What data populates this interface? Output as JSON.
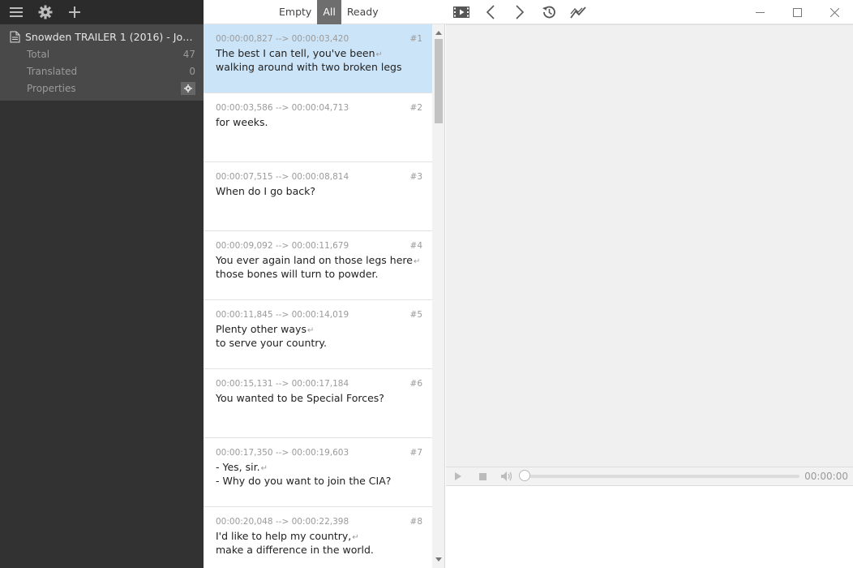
{
  "window_title": "",
  "sidebar": {
    "toolbar": {
      "menu_icon": "hamburger-icon",
      "settings_icon": "gear-icon",
      "add_icon": "plus-icon"
    },
    "file_name": "Snowden TRAILER 1 (2016) - Josep...",
    "stats": [
      {
        "label": "Total",
        "value": "47"
      },
      {
        "label": "Translated",
        "value": "0"
      }
    ],
    "properties_label": "Properties"
  },
  "filters": {
    "empty": "Empty",
    "all": "All",
    "ready": "Ready",
    "active": "All"
  },
  "nav_icons": [
    "video-icon",
    "chevron-left-icon",
    "chevron-right-icon",
    "history-icon",
    "chart-icon"
  ],
  "subtitles": [
    {
      "num": "#1",
      "time": "00:00:00,827 --> 00:00:03,420",
      "lines": [
        "The best I can tell, you've been",
        "walking around with two broken legs"
      ],
      "selected": true
    },
    {
      "num": "#2",
      "time": "00:00:03,586 --> 00:00:04,713",
      "lines": [
        "for weeks."
      ]
    },
    {
      "num": "#3",
      "time": "00:00:07,515 --> 00:00:08,814",
      "lines": [
        "When do I go back?"
      ]
    },
    {
      "num": "#4",
      "time": "00:00:09,092 --> 00:00:11,679",
      "lines": [
        "You ever again land on those legs here",
        "those bones will turn to powder."
      ]
    },
    {
      "num": "#5",
      "time": "00:00:11,845 --> 00:00:14,019",
      "lines": [
        "Plenty other ways",
        "to serve your country."
      ]
    },
    {
      "num": "#6",
      "time": "00:00:15,131 --> 00:00:17,184",
      "lines": [
        "You wanted to be Special Forces?"
      ]
    },
    {
      "num": "#7",
      "time": "00:00:17,350 --> 00:00:19,603",
      "lines": [
        "- Yes, sir.",
        "- Why do you want to join the CIA?"
      ]
    },
    {
      "num": "#8",
      "time": "00:00:20,048 --> 00:00:22,398",
      "lines": [
        "I'd like to help my country,",
        "make a difference in the world."
      ]
    }
  ],
  "player": {
    "time": "00:00:00",
    "progress": 0
  },
  "colors": {
    "sidebar": "#323232",
    "panel": "#494949",
    "selected": "#cce4f7",
    "active_filter": "#6e6e6e"
  }
}
